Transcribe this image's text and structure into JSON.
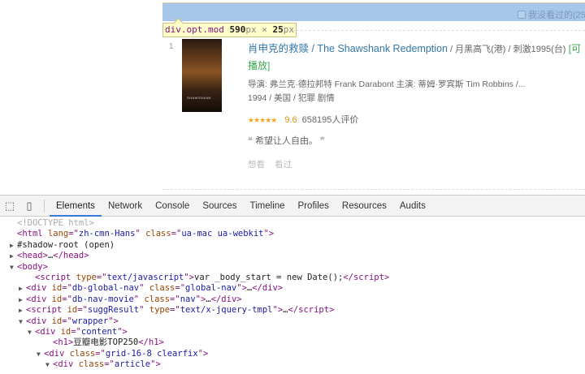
{
  "page": {
    "filter_checkbox_label": "我没看过的(25",
    "inspector_tooltip": {
      "selector": "div.opt.mod",
      "width": "590",
      "height": "25",
      "unit": "px",
      "times": "×"
    },
    "movie": {
      "rank": "1",
      "poster_text": "SHAWSHANK",
      "title_cn": "肖申克的救赎",
      "title_en": " / The Shawshank Redemption",
      "title_other": " / 月黑高飞(港) / 刺激1995(台)",
      "playable": " [可播放]",
      "director_cast": "导演: 弗兰克·德拉邦特 Frank Darabont   主演: 蒂姆·罗宾斯 Tim Robbins /...",
      "meta": "1994 / 美国 / 犯罪 剧情",
      "stars": "★★★★★",
      "rating": "9.6",
      "votes": "658195人评价",
      "quote_open": "❝",
      "quote": "希望让人自由。",
      "quote_close": "❞",
      "actions": [
        "想看",
        "看过"
      ]
    }
  },
  "devtools": {
    "tabs": [
      "Elements",
      "Network",
      "Console",
      "Sources",
      "Timeline",
      "Profiles",
      "Resources",
      "Audits"
    ],
    "active_tab": "Elements",
    "lines": [
      {
        "indent": 0,
        "arrow": "",
        "parts": [
          {
            "t": "<!DOCTYPE html>",
            "c": "doc"
          }
        ]
      },
      {
        "indent": 0,
        "arrow": "",
        "parts": [
          {
            "t": "<html ",
            "c": "tag"
          },
          {
            "t": "lang",
            "c": "attr"
          },
          {
            "t": "=\"",
            "c": "tag"
          },
          {
            "t": "zh-cmn-Hans",
            "c": "val"
          },
          {
            "t": "\" ",
            "c": "tag"
          },
          {
            "t": "class",
            "c": "attr"
          },
          {
            "t": "=\"",
            "c": "tag"
          },
          {
            "t": "ua-mac ua-webkit",
            "c": "val"
          },
          {
            "t": "\">",
            "c": "tag"
          }
        ]
      },
      {
        "indent": 0,
        "arrow": "▶",
        "parts": [
          {
            "t": "#shadow-root (open)",
            "c": "text"
          }
        ]
      },
      {
        "indent": 0,
        "arrow": "▶",
        "parts": [
          {
            "t": "<head>",
            "c": "tag"
          },
          {
            "t": "…",
            "c": "text"
          },
          {
            "t": "</head>",
            "c": "tag"
          }
        ]
      },
      {
        "indent": 0,
        "arrow": "▼",
        "parts": [
          {
            "t": "<body>",
            "c": "tag"
          }
        ]
      },
      {
        "indent": 2,
        "arrow": "",
        "parts": [
          {
            "t": "<script ",
            "c": "tag"
          },
          {
            "t": "type",
            "c": "attr"
          },
          {
            "t": "=\"",
            "c": "tag"
          },
          {
            "t": "text/javascript",
            "c": "val"
          },
          {
            "t": "\">",
            "c": "tag"
          },
          {
            "t": "var _body_start = new Date();",
            "c": "text"
          },
          {
            "t": "</script>",
            "c": "tag"
          }
        ]
      },
      {
        "indent": 1,
        "arrow": "▶",
        "parts": [
          {
            "t": "<div ",
            "c": "tag"
          },
          {
            "t": "id",
            "c": "attr"
          },
          {
            "t": "=\"",
            "c": "tag"
          },
          {
            "t": "db-global-nav",
            "c": "val"
          },
          {
            "t": "\" ",
            "c": "tag"
          },
          {
            "t": "class",
            "c": "attr"
          },
          {
            "t": "=\"",
            "c": "tag"
          },
          {
            "t": "global-nav",
            "c": "val"
          },
          {
            "t": "\">",
            "c": "tag"
          },
          {
            "t": "…",
            "c": "text"
          },
          {
            "t": "</div>",
            "c": "tag"
          }
        ]
      },
      {
        "indent": 1,
        "arrow": "▶",
        "parts": [
          {
            "t": "<div ",
            "c": "tag"
          },
          {
            "t": "id",
            "c": "attr"
          },
          {
            "t": "=\"",
            "c": "tag"
          },
          {
            "t": "db-nav-movie",
            "c": "val"
          },
          {
            "t": "\" ",
            "c": "tag"
          },
          {
            "t": "class",
            "c": "attr"
          },
          {
            "t": "=\"",
            "c": "tag"
          },
          {
            "t": "nav",
            "c": "val"
          },
          {
            "t": "\">",
            "c": "tag"
          },
          {
            "t": "…",
            "c": "text"
          },
          {
            "t": "</div>",
            "c": "tag"
          }
        ]
      },
      {
        "indent": 1,
        "arrow": "▶",
        "parts": [
          {
            "t": "<script ",
            "c": "tag"
          },
          {
            "t": "id",
            "c": "attr"
          },
          {
            "t": "=\"",
            "c": "tag"
          },
          {
            "t": "suggResult",
            "c": "val"
          },
          {
            "t": "\" ",
            "c": "tag"
          },
          {
            "t": "type",
            "c": "attr"
          },
          {
            "t": "=\"",
            "c": "tag"
          },
          {
            "t": "text/x-jquery-tmpl",
            "c": "val"
          },
          {
            "t": "\">",
            "c": "tag"
          },
          {
            "t": "…",
            "c": "text"
          },
          {
            "t": "</script>",
            "c": "tag"
          }
        ]
      },
      {
        "indent": 1,
        "arrow": "▼",
        "parts": [
          {
            "t": "<div ",
            "c": "tag"
          },
          {
            "t": "id",
            "c": "attr"
          },
          {
            "t": "=\"",
            "c": "tag"
          },
          {
            "t": "wrapper",
            "c": "val"
          },
          {
            "t": "\">",
            "c": "tag"
          }
        ]
      },
      {
        "indent": 2,
        "arrow": "▼",
        "parts": [
          {
            "t": "<div ",
            "c": "tag"
          },
          {
            "t": "id",
            "c": "attr"
          },
          {
            "t": "=\"",
            "c": "tag"
          },
          {
            "t": "content",
            "c": "val"
          },
          {
            "t": "\">",
            "c": "tag"
          }
        ]
      },
      {
        "indent": 4,
        "arrow": "",
        "parts": [
          {
            "t": "<h1>",
            "c": "tag"
          },
          {
            "t": "豆瓣电影TOP250",
            "c": "text"
          },
          {
            "t": "</h1>",
            "c": "tag"
          }
        ]
      },
      {
        "indent": 3,
        "arrow": "▼",
        "parts": [
          {
            "t": "<div ",
            "c": "tag"
          },
          {
            "t": "class",
            "c": "attr"
          },
          {
            "t": "=\"",
            "c": "tag"
          },
          {
            "t": "grid-16-8 clearfix",
            "c": "val"
          },
          {
            "t": "\">",
            "c": "tag"
          }
        ]
      },
      {
        "indent": 4,
        "arrow": "▼",
        "parts": [
          {
            "t": "<div ",
            "c": "tag"
          },
          {
            "t": "class",
            "c": "attr"
          },
          {
            "t": "=\"",
            "c": "tag"
          },
          {
            "t": "article",
            "c": "val"
          },
          {
            "t": "\">",
            "c": "tag"
          }
        ]
      }
    ]
  }
}
